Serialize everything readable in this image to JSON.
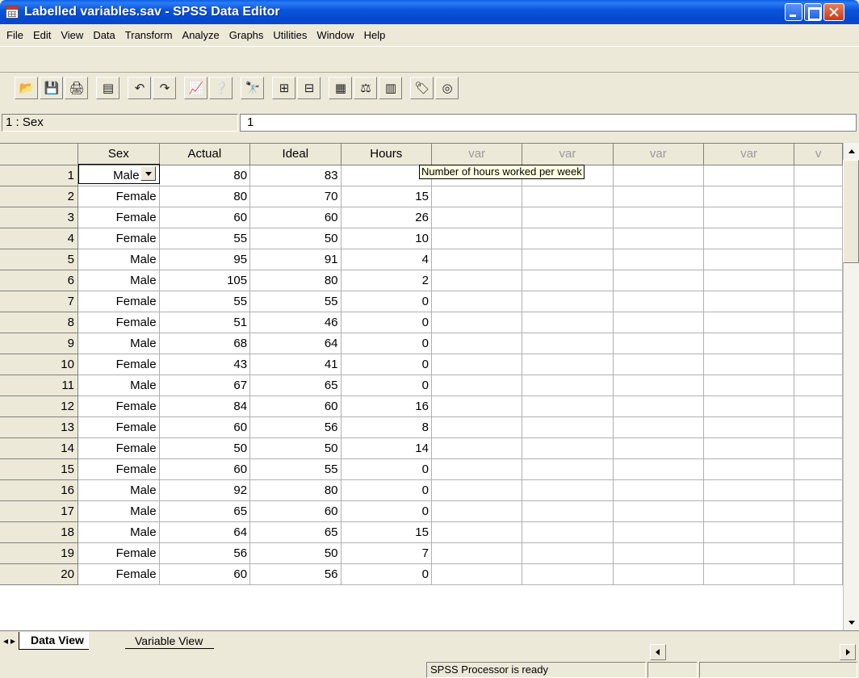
{
  "window": {
    "title": "Labelled variables.sav - SPSS Data Editor"
  },
  "menu": [
    "File",
    "Edit",
    "View",
    "Data",
    "Transform",
    "Analyze",
    "Graphs",
    "Utilities",
    "Window",
    "Help"
  ],
  "toolbar": [
    {
      "icon": "open-folder-icon",
      "glyph": "📂"
    },
    {
      "icon": "save-icon",
      "glyph": "💾"
    },
    {
      "icon": "print-icon",
      "glyph": "🖨"
    },
    {
      "sep": true
    },
    {
      "icon": "dialog-recall-icon",
      "glyph": "▤"
    },
    {
      "sep": true
    },
    {
      "icon": "undo-icon",
      "glyph": "↶"
    },
    {
      "icon": "redo-icon",
      "glyph": "↷"
    },
    {
      "sep": true
    },
    {
      "icon": "goto-chart-icon",
      "glyph": "📈"
    },
    {
      "icon": "goto-case-icon",
      "glyph": "❔"
    },
    {
      "sep": true
    },
    {
      "icon": "find-icon",
      "glyph": "🔭"
    },
    {
      "sep": true
    },
    {
      "icon": "insert-cases-icon",
      "glyph": "⊞"
    },
    {
      "icon": "insert-variable-icon",
      "glyph": "⊟"
    },
    {
      "sep": true
    },
    {
      "icon": "split-file-icon",
      "glyph": "▦"
    },
    {
      "icon": "weight-cases-icon",
      "glyph": "⚖"
    },
    {
      "icon": "select-cases-icon",
      "glyph": "▥"
    },
    {
      "sep": true
    },
    {
      "icon": "value-labels-icon",
      "glyph": "🏷"
    },
    {
      "icon": "use-sets-icon",
      "glyph": "◎"
    }
  ],
  "cell_editor": {
    "ref": "1 : Sex",
    "value": "1"
  },
  "columns": [
    "Sex",
    "Actual",
    "Ideal",
    "Hours",
    "var",
    "var",
    "var",
    "var",
    "v"
  ],
  "rows": [
    {
      "n": "1",
      "sex": "Male",
      "actual": "80",
      "ideal": "83",
      "hours": "1"
    },
    {
      "n": "2",
      "sex": "Female",
      "actual": "80",
      "ideal": "70",
      "hours": "15"
    },
    {
      "n": "3",
      "sex": "Female",
      "actual": "60",
      "ideal": "60",
      "hours": "26"
    },
    {
      "n": "4",
      "sex": "Female",
      "actual": "55",
      "ideal": "50",
      "hours": "10"
    },
    {
      "n": "5",
      "sex": "Male",
      "actual": "95",
      "ideal": "91",
      "hours": "4"
    },
    {
      "n": "6",
      "sex": "Male",
      "actual": "105",
      "ideal": "80",
      "hours": "2"
    },
    {
      "n": "7",
      "sex": "Female",
      "actual": "55",
      "ideal": "55",
      "hours": "0"
    },
    {
      "n": "8",
      "sex": "Female",
      "actual": "51",
      "ideal": "46",
      "hours": "0"
    },
    {
      "n": "9",
      "sex": "Male",
      "actual": "68",
      "ideal": "64",
      "hours": "0"
    },
    {
      "n": "10",
      "sex": "Female",
      "actual": "43",
      "ideal": "41",
      "hours": "0"
    },
    {
      "n": "11",
      "sex": "Male",
      "actual": "67",
      "ideal": "65",
      "hours": "0"
    },
    {
      "n": "12",
      "sex": "Female",
      "actual": "84",
      "ideal": "60",
      "hours": "16"
    },
    {
      "n": "13",
      "sex": "Female",
      "actual": "60",
      "ideal": "56",
      "hours": "8"
    },
    {
      "n": "14",
      "sex": "Female",
      "actual": "50",
      "ideal": "50",
      "hours": "14"
    },
    {
      "n": "15",
      "sex": "Female",
      "actual": "60",
      "ideal": "55",
      "hours": "0"
    },
    {
      "n": "16",
      "sex": "Male",
      "actual": "92",
      "ideal": "80",
      "hours": "0"
    },
    {
      "n": "17",
      "sex": "Male",
      "actual": "65",
      "ideal": "60",
      "hours": "0"
    },
    {
      "n": "18",
      "sex": "Male",
      "actual": "64",
      "ideal": "65",
      "hours": "15"
    },
    {
      "n": "19",
      "sex": "Female",
      "actual": "56",
      "ideal": "50",
      "hours": "7"
    },
    {
      "n": "20",
      "sex": "Female",
      "actual": "60",
      "ideal": "56",
      "hours": "0"
    }
  ],
  "tooltip": "Number of hours worked per week",
  "tabs": {
    "data_view": "Data View",
    "variable_view": "Variable View"
  },
  "status": {
    "processor": "SPSS Processor  is ready"
  }
}
